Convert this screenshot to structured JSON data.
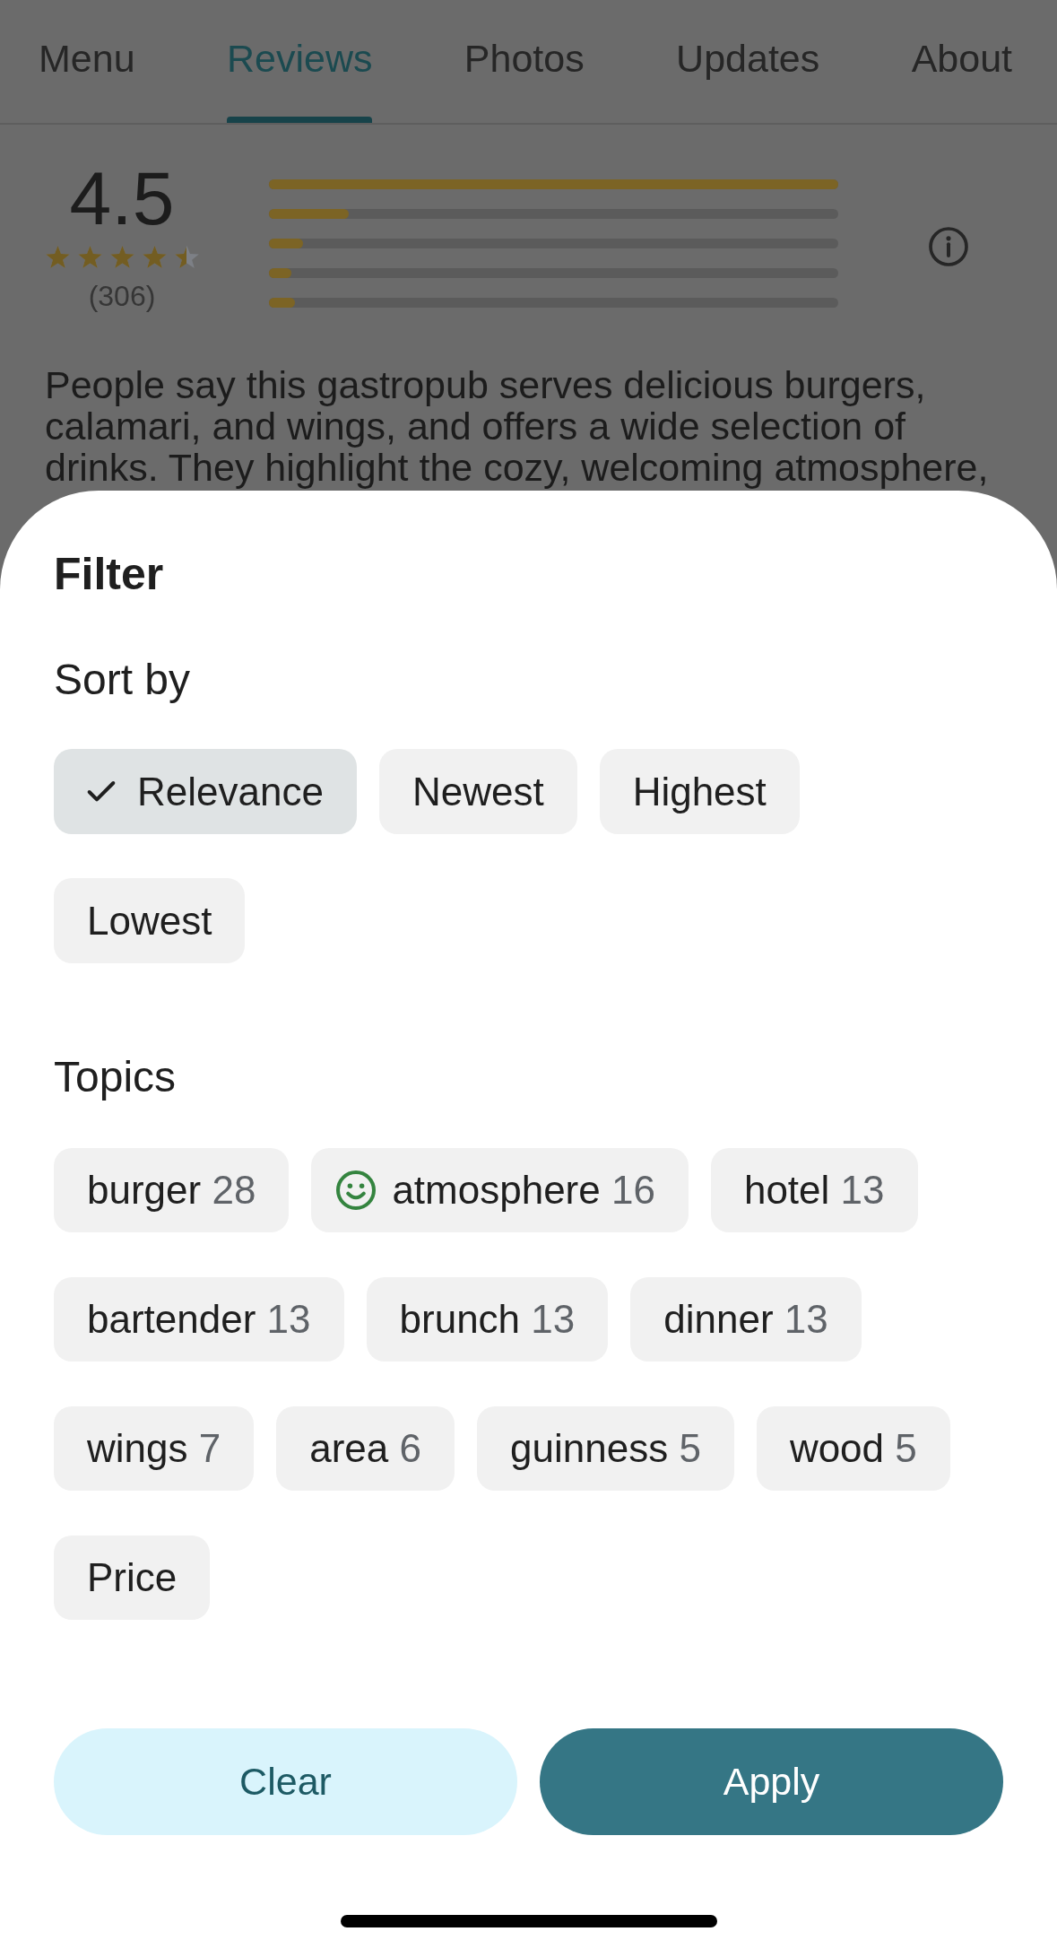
{
  "tabs": [
    {
      "label": "Menu",
      "selected": false
    },
    {
      "label": "Reviews",
      "selected": true
    },
    {
      "label": "Photos",
      "selected": false
    },
    {
      "label": "Updates",
      "selected": false
    },
    {
      "label": "About",
      "selected": false
    }
  ],
  "rating": {
    "score": "4.5",
    "stars": 4.5,
    "count": "(306)",
    "bars": [
      {
        "level": 1
      },
      {
        "level": 0.14
      },
      {
        "level": 0.06
      },
      {
        "level": 0.04
      },
      {
        "level": 0.045
      }
    ]
  },
  "summary": "People say this gastropub serves delicious burgers, calamari, and wings, and offers a wide selection of drinks. They highlight the cozy, welcoming atmosphere,",
  "filter_sheet": {
    "title": "Filter",
    "sort_by": {
      "heading": "Sort by",
      "options": [
        {
          "label": "Relevance",
          "selected": true
        },
        {
          "label": "Newest",
          "selected": false
        },
        {
          "label": "Highest",
          "selected": false
        },
        {
          "label": "Lowest",
          "selected": false
        }
      ]
    },
    "topics": {
      "heading": "Topics",
      "items": [
        {
          "label": "burger",
          "count": "28",
          "kind": "plain",
          "selected": false
        },
        {
          "label": "atmosphere",
          "count": "16",
          "kind": "positive",
          "selected": false
        },
        {
          "label": "hotel",
          "count": "13",
          "kind": "plain",
          "selected": false
        },
        {
          "label": "bartender",
          "count": "13",
          "kind": "plain",
          "selected": false
        },
        {
          "label": "brunch",
          "count": "13",
          "kind": "plain",
          "selected": false
        },
        {
          "label": "dinner",
          "count": "13",
          "kind": "plain",
          "selected": false
        },
        {
          "label": "wings",
          "count": "7",
          "kind": "plain",
          "selected": false
        },
        {
          "label": "area",
          "count": "6",
          "kind": "plain",
          "selected": false
        },
        {
          "label": "guinness",
          "count": "5",
          "kind": "plain",
          "selected": false
        },
        {
          "label": "wood",
          "count": "5",
          "kind": "plain",
          "selected": false
        },
        {
          "label": "Price",
          "kind": "plain",
          "selected": false
        }
      ]
    },
    "buttons": [
      {
        "label": "Clear",
        "kind": "secondary"
      },
      {
        "label": "Apply",
        "kind": "primary"
      }
    ]
  }
}
